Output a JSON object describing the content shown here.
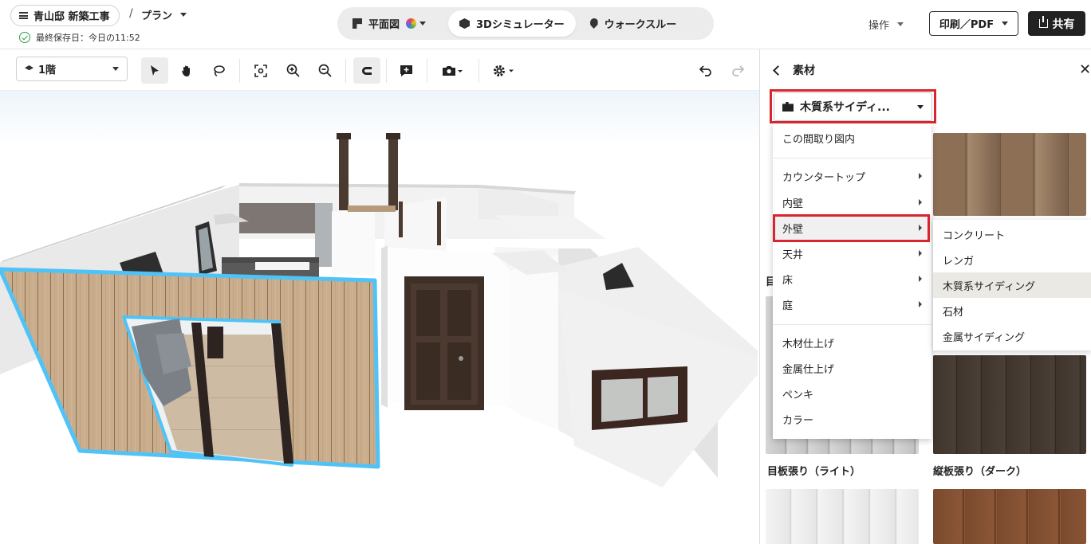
{
  "header": {
    "project_name": "青山邸 新築工事",
    "separator": "/",
    "plan_label": "プラン",
    "saved_text": "最終保存日：今日の11:52",
    "modes": [
      {
        "label": "平面図",
        "icon": "flag-icon"
      },
      {
        "label": "3Dシミュレーター",
        "icon": "cube-icon",
        "active": true
      },
      {
        "label": "ウォークスルー",
        "icon": "map-pin-icon"
      }
    ],
    "operations_label": "操作",
    "print_label": "印刷／PDF",
    "share_label": "共有"
  },
  "toolbar": {
    "floor_label": "1階",
    "tools": [
      "select-arrow-icon",
      "hand-pan-icon",
      "lasso-icon",
      "fit-view-icon",
      "zoom-in-icon",
      "zoom-out-icon",
      "magnet-snap-icon",
      "add-comment-icon",
      "camera-icon",
      "settings-gear-icon",
      "undo-icon",
      "redo-icon"
    ]
  },
  "panel": {
    "title": "素材",
    "category_selected": "木質系サイディ...",
    "stub_text": "目",
    "menu_items": [
      {
        "label": "この間取り図内"
      },
      {
        "label": "カウンタートップ"
      },
      {
        "label": "内壁"
      },
      {
        "label": "外壁"
      },
      {
        "label": "天井"
      },
      {
        "label": "床"
      },
      {
        "label": "庭"
      },
      {
        "label": "木材仕上げ"
      },
      {
        "label": "金属仕上げ"
      },
      {
        "label": "ペンキ"
      },
      {
        "label": "カラー"
      }
    ],
    "submenu_items": [
      {
        "label": "コンクリート"
      },
      {
        "label": "レンガ"
      },
      {
        "label": "木質系サイディング"
      },
      {
        "label": "石材"
      },
      {
        "label": "金属サイディング"
      }
    ],
    "swatches": [
      {
        "label": "目板張り（ライト）"
      },
      {
        "label": "縦板張り（ダーク）"
      }
    ]
  },
  "colors": {
    "highlight_red": "#d7262e",
    "selection_blue": "#4fc3f7",
    "wood_light": "#c9ad8c",
    "wood_dark": "#3f352d"
  }
}
